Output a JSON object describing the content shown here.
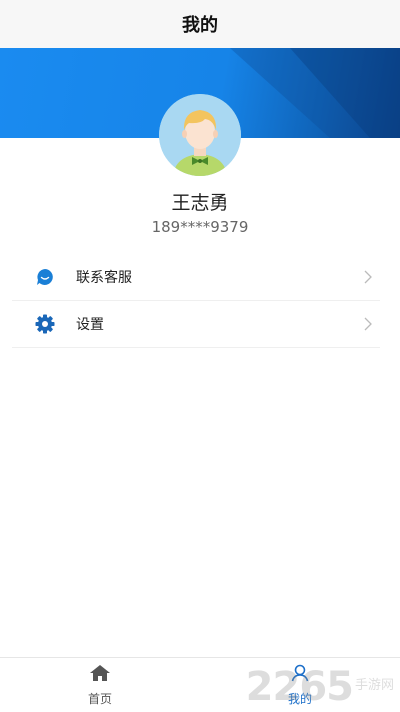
{
  "header": {
    "title": "我的"
  },
  "profile": {
    "name": "王志勇",
    "phone": "189****9379"
  },
  "menu": [
    {
      "label": "联系客服",
      "icon": "customer-service-icon"
    },
    {
      "label": "设置",
      "icon": "gear-icon"
    }
  ],
  "tabs": [
    {
      "label": "首页",
      "icon": "home-icon",
      "active": false
    },
    {
      "label": "我的",
      "icon": "person-icon",
      "active": true
    }
  ],
  "watermark": {
    "number": "2265",
    "text": "手游网"
  },
  "colors": {
    "accent": "#1a87ea",
    "tab_active": "#1c6fc9",
    "tab_inactive": "#555555"
  }
}
